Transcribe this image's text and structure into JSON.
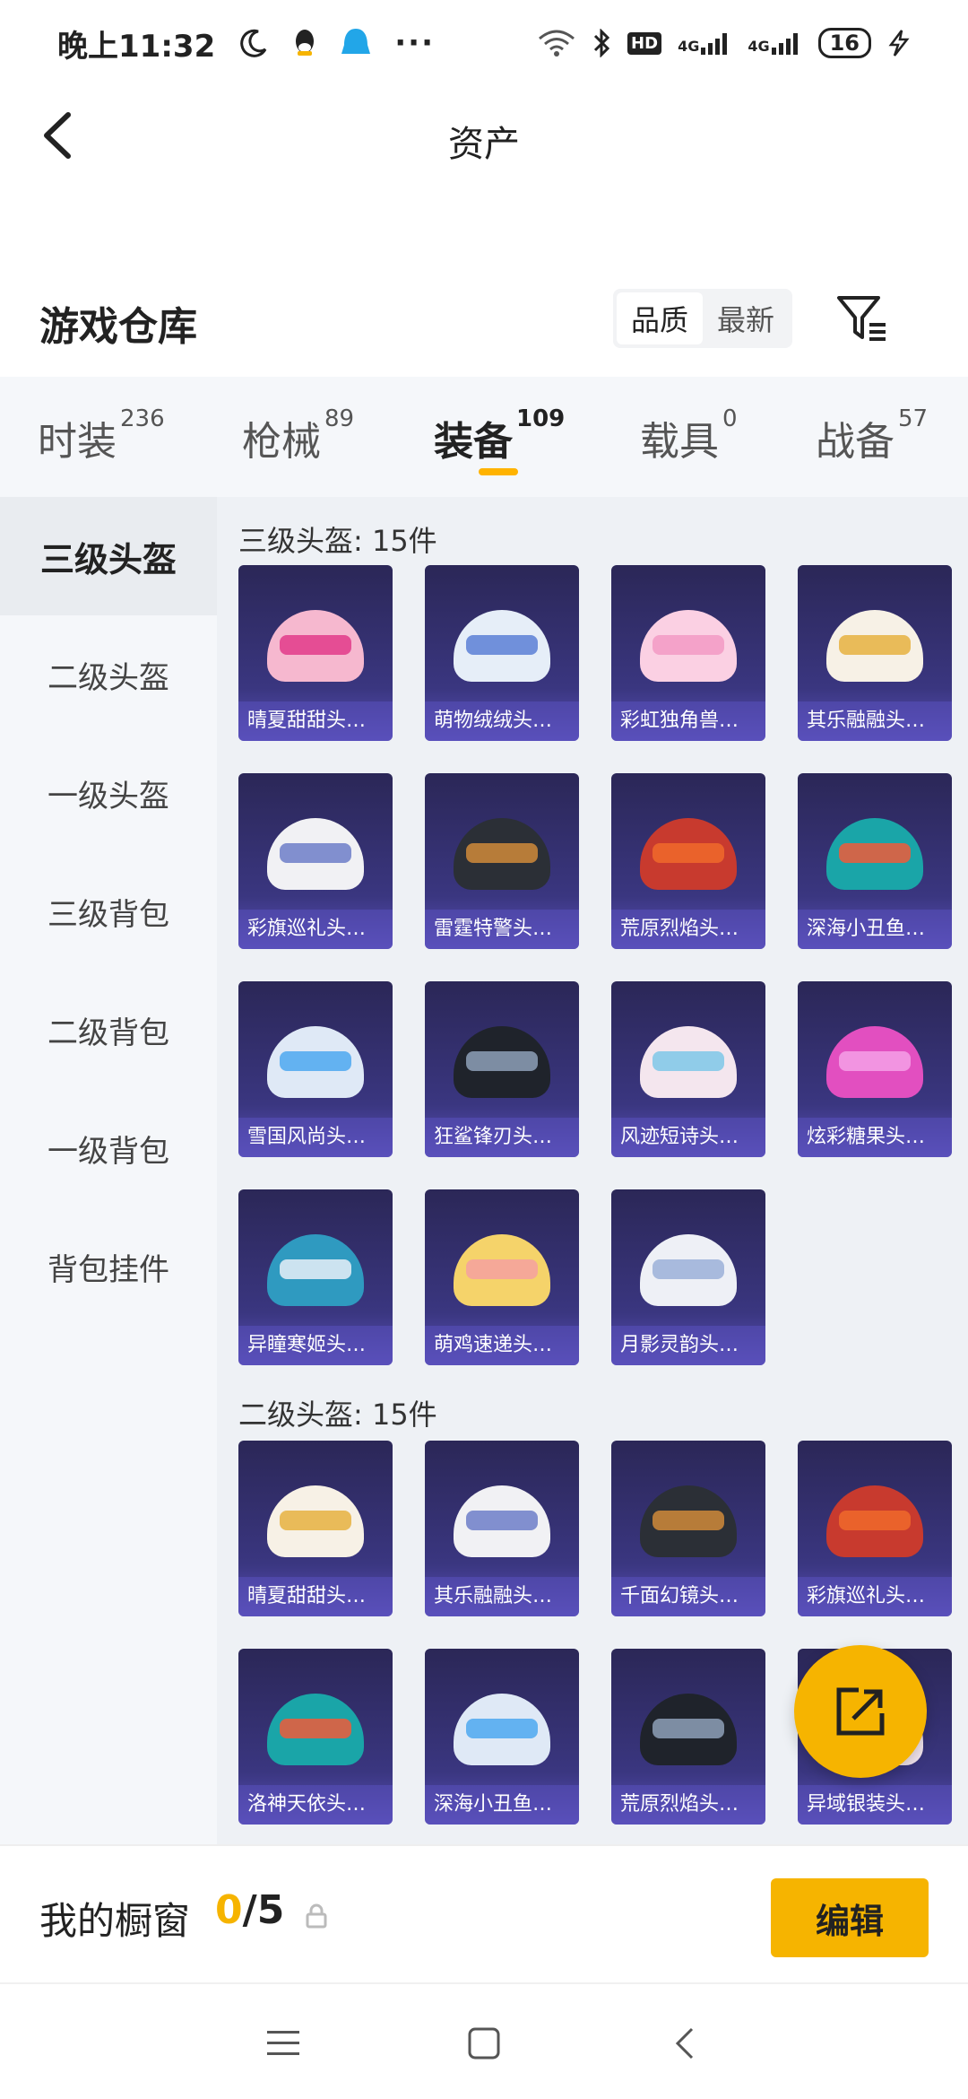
{
  "status": {
    "time": "晚上11:32",
    "hd": "HD",
    "signal1": "4G",
    "signal2": "4G",
    "battery": "16"
  },
  "header": {
    "title": "资产"
  },
  "section": {
    "title": "游戏仓库",
    "sort_options": [
      "品质",
      "最新"
    ]
  },
  "tabs": [
    {
      "label": "时装",
      "count": "236"
    },
    {
      "label": "枪械",
      "count": "89"
    },
    {
      "label": "装备",
      "count": "109"
    },
    {
      "label": "载具",
      "count": "0"
    },
    {
      "label": "战备",
      "count": "57"
    }
  ],
  "sidebar": {
    "items": [
      "三级头盔",
      "二级头盔",
      "一级头盔",
      "三级背包",
      "二级背包",
      "一级背包",
      "背包挂件"
    ]
  },
  "groups": [
    {
      "title": "三级头盔: 15件",
      "items": [
        "晴夏甜甜头盔...",
        "萌物绒绒头盔...",
        "彩虹独角兽头...",
        "其乐融融头盔...",
        "彩旗巡礼头盔...",
        "雷霆特警头盔...",
        "荒原烈焰头盔...",
        "深海小丑鱼头...",
        "雪国风尚头盔...",
        "狂鲨锋刃头盔...",
        "风迹短诗头盔...",
        "炫彩糖果头盔...",
        "异瞳寒姬头盔...",
        "萌鸡速递头盔...",
        "月影灵韵头盔..."
      ]
    },
    {
      "title": "二级头盔: 15件",
      "items": [
        "晴夏甜甜头盔...",
        "其乐融融头盔...",
        "千面幻镜头盔...",
        "彩旗巡礼头盔...",
        "洛神天依头盔...",
        "深海小丑鱼头...",
        "荒原烈焰头盔...",
        "异域银装头盔..."
      ]
    }
  ],
  "bottom": {
    "showcase_label": "我的橱窗",
    "current": "0",
    "total": "/5",
    "edit_label": "编辑"
  },
  "colors": {
    "accent": "#f6b400",
    "card_top": "#2b2757",
    "card_bottom": "#5a50b8"
  }
}
